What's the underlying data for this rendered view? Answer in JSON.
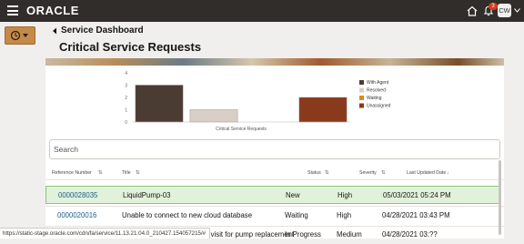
{
  "header": {
    "logo_text": "ORACLE",
    "notification_count": "3",
    "avatar_initials": "CW",
    "bar_color": "#312d2a"
  },
  "breadcrumb": {
    "back_label": "Service Dashboard"
  },
  "page": {
    "title": "Critical Service Requests"
  },
  "chart_data": {
    "type": "bar",
    "xlabel": "Critical Service Requests",
    "ylim": [
      0,
      4
    ],
    "yticks": [
      "0",
      "1",
      "2",
      "3",
      "4"
    ],
    "legend_position": "right",
    "series": [
      {
        "name": "With Agent",
        "color": "#4a3c33",
        "value": 3
      },
      {
        "name": "Resolved",
        "color": "#d8cfc6",
        "value": 1
      },
      {
        "name": "Waiting",
        "color": "#d98b22",
        "value": 0
      },
      {
        "name": "Unassigned",
        "color": "#8a3a1c",
        "value": 2
      }
    ]
  },
  "search": {
    "placeholder": "Search"
  },
  "table": {
    "columns": [
      "Reference Number",
      "Title",
      "Status",
      "Severity",
      "Last Updated Date"
    ],
    "sort_icons": [
      "⇅",
      "⇅",
      "⇅",
      "⇅",
      "↓"
    ],
    "rows": [
      {
        "ref": "0000028035",
        "title": "LiquidPump-03",
        "status": "New",
        "severity": "High",
        "updated": "05/03/2021 05:24 PM",
        "selected": true
      },
      {
        "ref": "0000020016",
        "title": "Unable to connect to new cloud database",
        "status": "Waiting",
        "severity": "High",
        "updated": "04/28/2021 03:43 PM",
        "selected": false
      },
      {
        "ref": "",
        "title": "te visit for pump replacement",
        "status": "In Progress",
        "severity": "Medium",
        "updated": "04/28/2021 03:??",
        "selected": false
      }
    ]
  },
  "status_url": "https://static-stage.oracle.com/cdn/fa/service/11.13.21.04.0_210427.154057215/#"
}
